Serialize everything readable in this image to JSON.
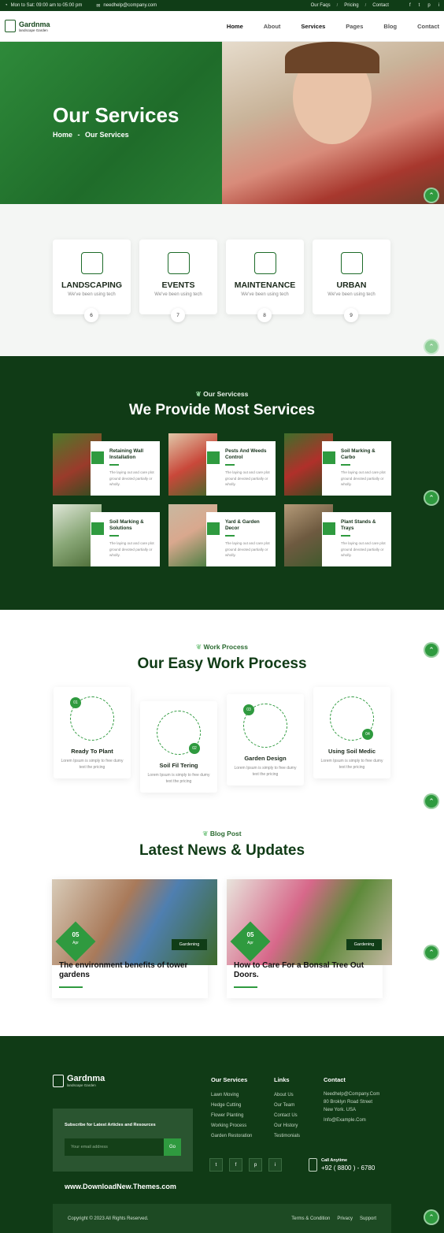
{
  "topbar": {
    "hours": "Mon to Sat: 09:00 am to 05:00 pm",
    "email": "needhelp@company.com",
    "links": [
      "Our Faqs",
      "Pricing",
      "Contact"
    ],
    "social": [
      "f",
      "t",
      "p",
      "i"
    ]
  },
  "brand": {
    "name": "Gardnma",
    "tagline": "landscape Garden"
  },
  "nav": [
    "Home",
    "About",
    "Services",
    "Pages",
    "Blog",
    "Contact"
  ],
  "hero": {
    "title": "Our Services",
    "crumb_home": "Home",
    "crumb_sep": "-",
    "crumb_current": "Our Services"
  },
  "services_cards": [
    {
      "title": "LANDSCAPING",
      "desc": "We've been using tech",
      "num": "6"
    },
    {
      "title": "EVENTS",
      "desc": "We've been using tech",
      "num": "7"
    },
    {
      "title": "MAINTENANCE",
      "desc": "We've been using tech",
      "num": "8"
    },
    {
      "title": "URBAN",
      "desc": "We've been using tech",
      "num": "9"
    }
  ],
  "provide": {
    "kicker": "Our Servicess",
    "heading": "We Provide Most Services",
    "items": [
      {
        "title": "Retaining Wall Installation",
        "desc": "The laying out and care plot ground devoted partially or wholly."
      },
      {
        "title": "Pests And Weeds Control",
        "desc": "The laying out and care plot ground devoted partially or wholly."
      },
      {
        "title": "Soil Marking & Carbo",
        "desc": "The laying out and care plot ground devoted partially or wholly."
      },
      {
        "title": "Soil Marking & Solutions",
        "desc": "The laying out and care plot ground devoted partially or wholly."
      },
      {
        "title": "Yard & Garden Decor",
        "desc": "The laying out and care plot ground devoted partially or wholly."
      },
      {
        "title": "Plant Stands & Trays",
        "desc": "The laying out and care plot ground devoted partially or wholly."
      }
    ]
  },
  "process": {
    "kicker": "Work Process",
    "heading": "Our Easy Work Process",
    "steps": [
      {
        "num": "01",
        "title": "Ready To Plant",
        "desc": "Lorem Ipsum is simply to free dumy text the pricing"
      },
      {
        "num": "02",
        "title": "Soil Fil Tering",
        "desc": "Lorem Ipsum is simply to free dumy text the pricing"
      },
      {
        "num": "03",
        "title": "Garden Design",
        "desc": "Lorem Ipsum is simply to free dumy text the pricing"
      },
      {
        "num": "04",
        "title": "Using Soil Medic",
        "desc": "Lorem Ipsum is simply to free dumy text the pricing"
      }
    ]
  },
  "blog": {
    "kicker": "Blog Post",
    "heading": "Latest News & Updates",
    "posts": [
      {
        "day": "05",
        "month": "Apr",
        "tag": "Gardening",
        "title": "The environment benefits of tower gardens"
      },
      {
        "day": "05",
        "month": "Apr",
        "tag": "Gardening",
        "title": "How to Care For a Bonsal Tree Out Doors."
      }
    ]
  },
  "footer": {
    "services_title": "Our Services",
    "services": [
      "Lawn Moving",
      "Hedge Cutting",
      "Flower Planting",
      "Working Process",
      "Garden Restoration"
    ],
    "links_title": "Links",
    "links": [
      "About Us",
      "Our Team",
      "Contact Us",
      "Our History",
      "Testimonials"
    ],
    "contact_title": "Contact",
    "contact": [
      "Needhelp@Company.Com",
      "80 Broklyn Road Street",
      "New York. USA",
      "Info@Example.Com"
    ],
    "subscribe_title": "Subscribe for Latest Articles and Resources",
    "email_placeholder": "Your email address",
    "go": "Go",
    "call_label": "Call Anytime",
    "phone": "+92 ( 8800 ) - 6780",
    "watermark": "www.DownloadNew.Themes.com",
    "copyright": "Copyright © 2023 All Rights Reserved.",
    "bottom_links": [
      "Terms & Condition",
      "Privacy",
      "Support"
    ]
  },
  "colors": {
    "primary": "#2f9a3f",
    "dark": "#103b16"
  }
}
